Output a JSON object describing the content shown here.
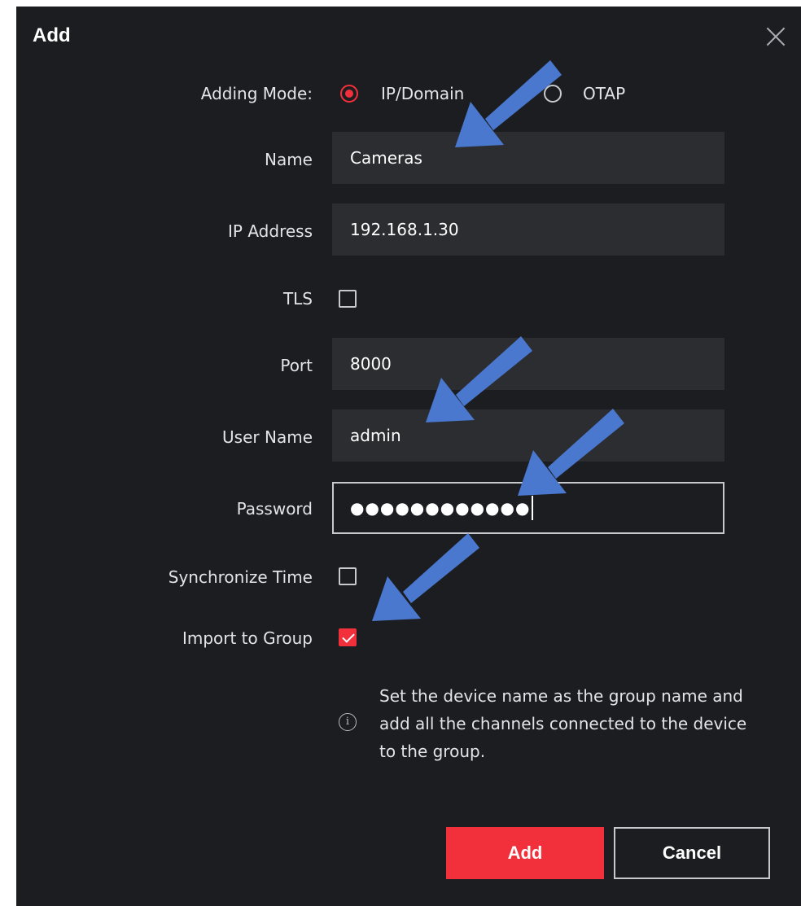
{
  "dialog": {
    "title": "Add",
    "close_icon": "close-icon"
  },
  "form": {
    "adding_mode": {
      "label": "Adding Mode:",
      "options": [
        {
          "label": "IP/Domain",
          "selected": true
        },
        {
          "label": "OTAP",
          "selected": false
        }
      ]
    },
    "name": {
      "label": "Name",
      "value": "Cameras"
    },
    "ip_address": {
      "label": "IP Address",
      "value": "192.168.1.30"
    },
    "tls": {
      "label": "TLS",
      "checked": false
    },
    "port": {
      "label": "Port",
      "value": "8000"
    },
    "user_name": {
      "label": "User Name",
      "value": "admin"
    },
    "password": {
      "label": "Password",
      "masked_value": "●●●●●●●●●●●●"
    },
    "sync_time": {
      "label": "Synchronize Time",
      "checked": false
    },
    "import_to_group": {
      "label": "Import to Group",
      "checked": true
    },
    "info": {
      "icon": "info-icon",
      "lines": [
        "Set the device name as the group name and",
        "add all the channels connected to the device",
        "to the group."
      ]
    }
  },
  "buttons": {
    "add_label": "Add",
    "cancel_label": "Cancel"
  },
  "colors": {
    "background": "#1c1d20",
    "field": "#2b2d31",
    "accent": "#f2303b",
    "annotation_arrow": "#4a78cf"
  }
}
